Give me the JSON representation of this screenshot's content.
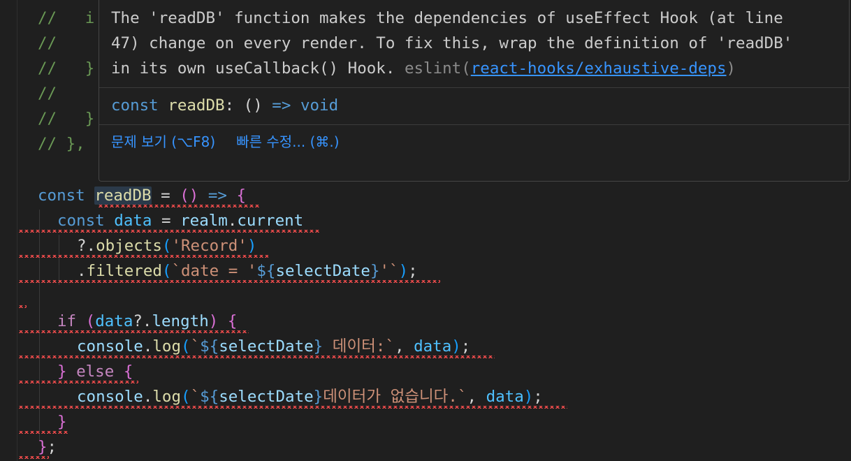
{
  "hover": {
    "message_lines": [
      "The 'readDB' function makes the dependencies of useEffect Hook (at line",
      "47) change on every render. To fix this, wrap the definition of 'readDB'",
      "in its own useCallback() Hook."
    ],
    "source": "eslint",
    "rule": "react-hooks/exhaustive-deps",
    "signature": {
      "keyword": "const",
      "name": "readDB",
      "type_open": ": () ",
      "arrow": "=>",
      "ret": "void"
    },
    "actions": {
      "view_problem": "문제 보기 (⌥F8)",
      "quick_fix": "빠른 수정... (⌘.)"
    }
  },
  "code": {
    "comments": [
      "//   i",
      "//",
      "//   }",
      "//",
      "//   }",
      "// },"
    ],
    "l_const": "const",
    "l_readDB": "readDB",
    "l_eq": " = ",
    "l_arrow": " => ",
    "l_data": "data",
    "l_realm": "realm",
    "l_current": "current",
    "l_objects": "objects",
    "l_record": "'Record'",
    "l_filtered": "filtered",
    "l_date_tpl": "`date = '",
    "l_tpl_open": "${",
    "l_selectDate": "selectDate",
    "l_tpl_close": "}",
    "l_tpl_end1": "'`",
    "l_if": "if",
    "l_length": "length",
    "l_console": "console",
    "l_log": "log",
    "l_tick": "`",
    "l_msg1": " 데이터:`",
    "l_else": "else",
    "l_msg2": "데이터가 없습니다.`"
  }
}
